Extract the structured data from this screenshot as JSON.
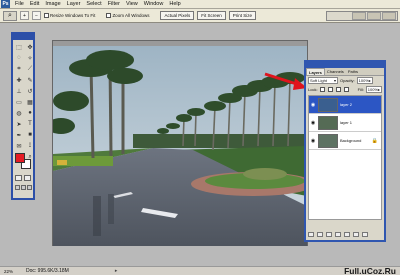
{
  "menubar": {
    "items": [
      "File",
      "Edit",
      "Image",
      "Layer",
      "Select",
      "Filter",
      "View",
      "Window",
      "Help"
    ]
  },
  "options": {
    "resize_windows_label": "Resize Windows To Fit",
    "zoom_all_label": "Zoom All Windows",
    "buttons": [
      "Actual Pixels",
      "Fit Screen",
      "Print Size"
    ]
  },
  "layers_panel": {
    "tabs": [
      "Layers",
      "Channels",
      "Paths"
    ],
    "blend_mode": "Soft Light",
    "opacity_label": "Opacity:",
    "opacity_value": "100%",
    "lock_label": "Lock:",
    "fill_label": "Fill:",
    "fill_value": "100%",
    "layers": [
      {
        "name": "layer 2",
        "selected": true
      },
      {
        "name": "layer 1",
        "selected": false
      },
      {
        "name": "Background",
        "selected": false
      }
    ]
  },
  "status": {
    "zoom": "22%",
    "doc_info": "Doc: 995.6K/3.18M"
  },
  "watermark": "Full.uCoz.Ru",
  "colors": {
    "foreground": "#e51b24",
    "background": "#ffffff",
    "palette_title": "#2f56b0",
    "annotation_arrow": "#e0141d"
  }
}
